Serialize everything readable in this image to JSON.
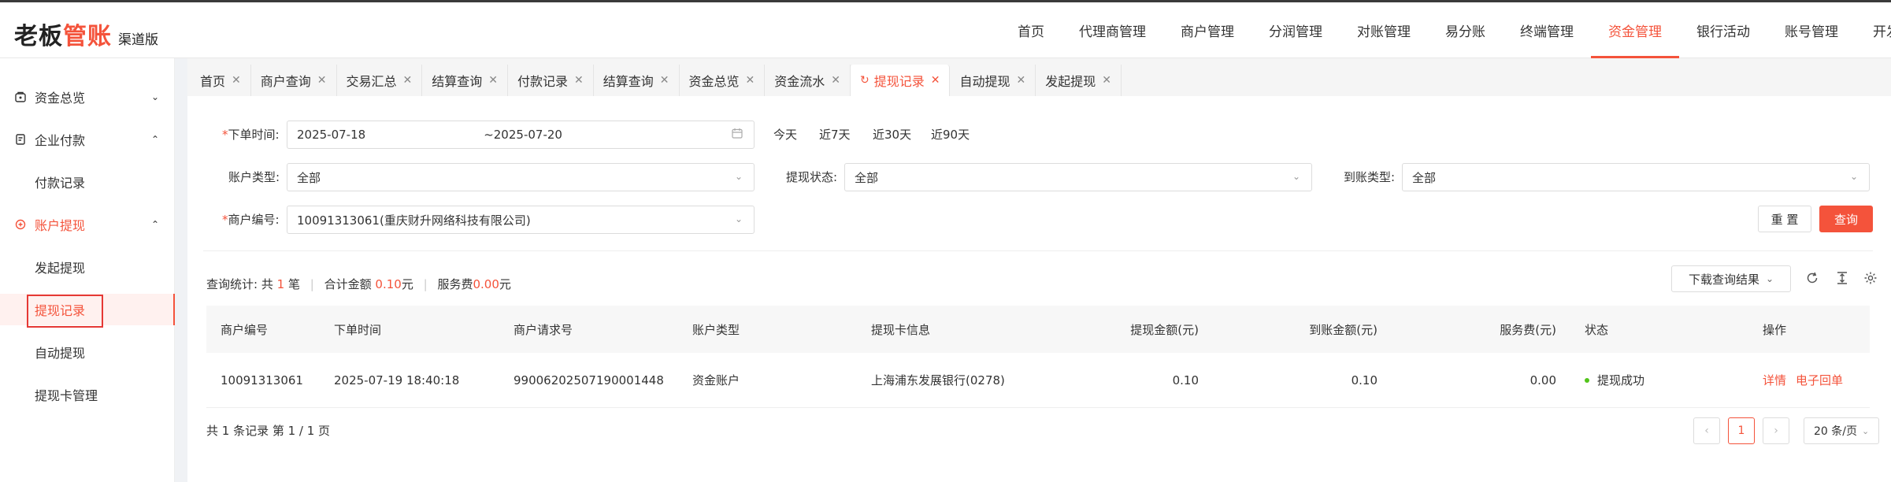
{
  "brand": {
    "main": "老板",
    "accent": "管账",
    "sub": "渠道版"
  },
  "topnav": [
    {
      "label": "首页"
    },
    {
      "label": "代理商管理"
    },
    {
      "label": "商户管理"
    },
    {
      "label": "分润管理"
    },
    {
      "label": "对账管理"
    },
    {
      "label": "易分账"
    },
    {
      "label": "终端管理"
    },
    {
      "label": "资金管理",
      "active": true
    },
    {
      "label": "银行活动"
    },
    {
      "label": "账号管理"
    },
    {
      "label": "开发者中心"
    }
  ],
  "sidebar": {
    "group_fund": "资金总览",
    "group_pay": "企业付款",
    "item_pay_records": "付款记录",
    "group_withdraw": "账户提现",
    "item_start_withdraw": "发起提现",
    "item_withdraw_records": "提现记录",
    "item_auto_withdraw": "自动提现",
    "item_card_manage": "提现卡管理"
  },
  "tabs": [
    {
      "label": "首页"
    },
    {
      "label": "商户查询"
    },
    {
      "label": "交易汇总"
    },
    {
      "label": "结算查询"
    },
    {
      "label": "付款记录"
    },
    {
      "label": "结算查询"
    },
    {
      "label": "资金总览"
    },
    {
      "label": "资金流水"
    },
    {
      "label": "提现记录",
      "active": true
    },
    {
      "label": "自动提现"
    },
    {
      "label": "发起提现"
    }
  ],
  "filters": {
    "order_time_label": "下单时间:",
    "date_start": "2025-07-18",
    "date_sep": "~",
    "date_end": "2025-07-20",
    "quick_today": "今天",
    "quick_7": "近7天",
    "quick_30": "近30天",
    "quick_90": "近90天",
    "account_type_label": "账户类型:",
    "account_type_value": "全部",
    "withdraw_status_label": "提现状态:",
    "withdraw_status_value": "全部",
    "arrival_type_label": "到账类型:",
    "arrival_type_value": "全部",
    "merchant_no_label": "商户编号:",
    "merchant_no_value": "10091313061(重庆财升网络科技有限公司)",
    "reset": "重 置",
    "query": "查询"
  },
  "stats": {
    "prefix": "查询统计:",
    "count_pre": "共",
    "count": "1",
    "count_unit": "笔",
    "total_label": "合计金额",
    "total": "0.10",
    "total_unit": "元",
    "fee_label": "服务费",
    "fee": "0.00",
    "fee_unit": "元"
  },
  "download_label": "下载查询结果",
  "table": {
    "headers": {
      "merchant_no": "商户编号",
      "order_time": "下单时间",
      "request_no": "商户请求号",
      "account_type": "账户类型",
      "card_info": "提现卡信息",
      "amount": "提现金额(元)",
      "arrival": "到账金额(元)",
      "fee": "服务费(元)",
      "status": "状态",
      "ops": "操作"
    },
    "rows": [
      {
        "merchant_no": "10091313061",
        "order_time": "2025-07-19 18:40:18",
        "request_no": "99006202507190001448",
        "account_type": "资金账户",
        "card_info": "上海浦东发展银行(0278)",
        "amount": "0.10",
        "arrival": "0.10",
        "fee": "0.00",
        "status": "提现成功",
        "op_detail": "详情",
        "op_receipt": "电子回单"
      }
    ]
  },
  "pagination": {
    "summary": "共 1 条记录 第 1 / 1 页",
    "current": "1",
    "page_size": "20 条/页"
  },
  "colors": {
    "accent": "#f4533b",
    "success": "#52c41a"
  }
}
